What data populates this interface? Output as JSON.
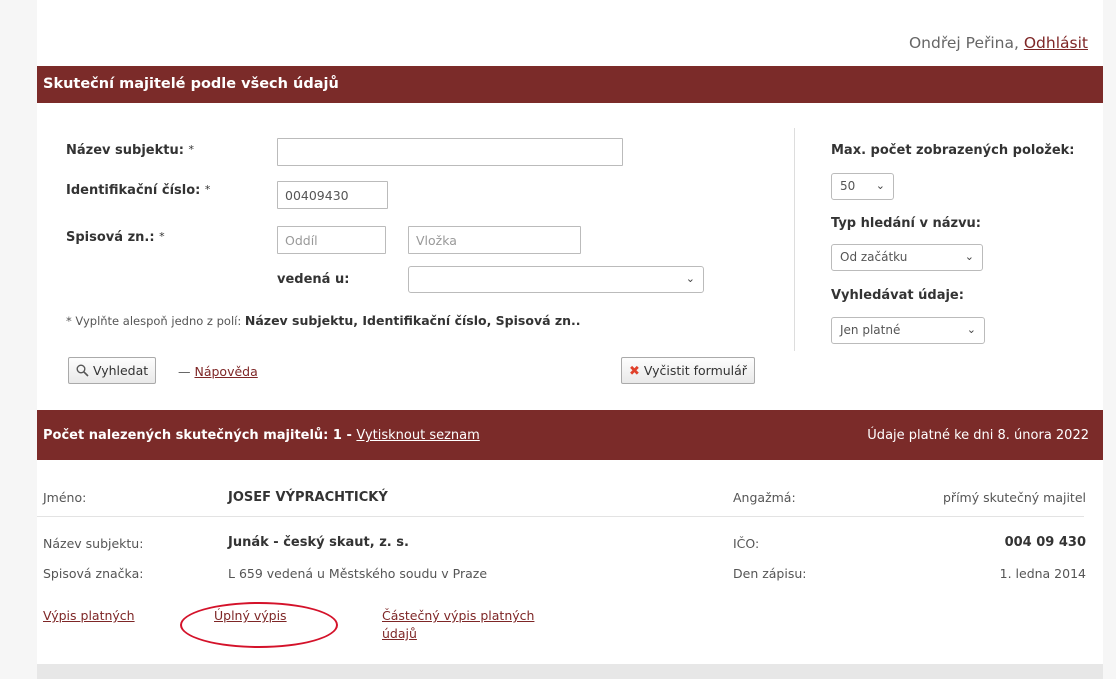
{
  "header": {
    "user_name": "Ondřej Peřina,",
    "logout_label": "Odhlásit"
  },
  "form_section": {
    "title": "Skuteční majitelé podle všech údajů",
    "subject_name_label": "Název subjektu:",
    "ic_label": "Identifikační číslo:",
    "ic_value": "00409430",
    "file_label": "Spisová zn.:",
    "required_mark": "*",
    "section_placeholder": "Oddíl",
    "insert_placeholder": "Vložka",
    "kept_at_label": "vedená u:",
    "kept_at_value": "",
    "note_prefix": "* Vyplňte alespoň jedno z polí:",
    "note_fields": "Název subjektu, Identifikační číslo, Spisová zn..",
    "search_button": "Vyhledat",
    "help_dash": "—",
    "help_link": "Nápověda",
    "clear_button": "Vyčistit formulář"
  },
  "options": {
    "max_items_label": "Max. počet zobrazených položek:",
    "max_items_value": "50",
    "search_type_label": "Typ hledání v názvu:",
    "search_type_value": "Od začátku",
    "search_data_label": "Vyhledávat údaje:",
    "search_data_value": "Jen platné"
  },
  "results_bar": {
    "count_text": "Počet nalezených skutečných majitelů: 1 -",
    "print_link": "Vytisknout seznam",
    "validity_text": "Údaje platné ke dni 8. února 2022"
  },
  "result": {
    "name_label": "Jméno:",
    "name_value": "JOSEF VÝPRACHTICKÝ",
    "engagement_label": "Angažmá:",
    "engagement_value": "přímý skutečný majitel",
    "subject_label": "Název subjektu:",
    "subject_value": "Junák - český skaut, z. s.",
    "ico_label": "IČO:",
    "ico_value": "004 09 430",
    "file_label": "Spisová značka:",
    "file_value": "L 659 vedená u Městského soudu v Praze",
    "entry_label": "Den zápisu:",
    "entry_value": "1. ledna 2014",
    "link_valid": "Výpis platných",
    "link_full": "Úplný výpis",
    "link_partial_1": "Částečný výpis platných",
    "link_partial_2": "údajů"
  },
  "colors": {
    "brand": "#7b2b29",
    "link": "#7e2626",
    "highlight": "#d4122a"
  }
}
